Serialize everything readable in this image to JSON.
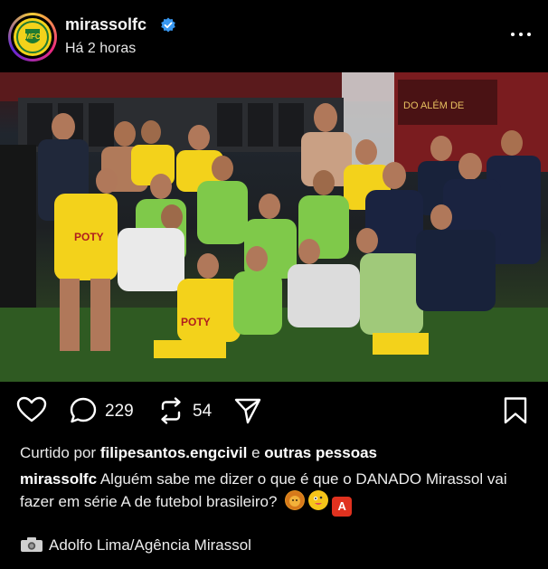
{
  "header": {
    "username": "mirassolfc",
    "time_ago": "Há 2 horas",
    "avatar_icon": "mirassol-crest-icon",
    "verified_icon": "verified-badge-icon",
    "more_icon": "more-options-icon"
  },
  "post": {
    "image_description_icon": "team-celebration-photo"
  },
  "actions": {
    "comments": "229",
    "reposts": "54"
  },
  "likes": {
    "prefix": "Curtido por",
    "user": "filipesantos.engcivil",
    "connector": "e",
    "others": "outras pessoas"
  },
  "caption": {
    "user": "mirassolfc",
    "text": "Alguém sabe me dizer o que é que o DANADO Mirassol vai fazer em série A de futebol brasileiro?",
    "emoji_3": "A"
  },
  "credit": {
    "text": "Adolfo Lima/Agência Mirassol"
  },
  "colors": {
    "background": "#000000",
    "verified": "#3897f0",
    "kit_yellow": "#f3d21b",
    "kit_green": "#7fc94a"
  }
}
